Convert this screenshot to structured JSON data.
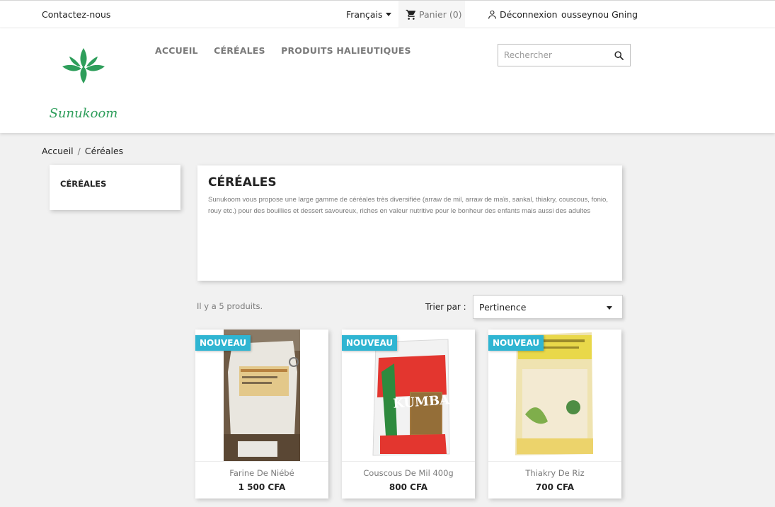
{
  "topbar": {
    "contact": "Contactez-nous",
    "language": "Français",
    "cart": "Panier (0)",
    "logout": "Déconnexion",
    "user": "ousseynou Gning"
  },
  "header": {
    "logo_text": "Sunukoom",
    "menu": [
      "ACCUEIL",
      "CÉRÉALES",
      "PRODUITS HALIEUTIQUES"
    ],
    "search_placeholder": "Rechercher"
  },
  "breadcrumb": [
    "Accueil",
    "Céréales"
  ],
  "sidebar": {
    "title": "CÉRÉALES"
  },
  "category": {
    "title": "CÉRÉALES",
    "description": "Sunukoom vous propose une large gamme de céréales très diversifiée (arraw de mil, arraw de maïs, sankal, thiakry, couscous, fonio, rouy etc.) pour des bouillies et dessert savoureux, riches en valeur nutritive pour le bonheur des enfants mais aussi des adultes"
  },
  "listing": {
    "count": "Il y a 5 produits.",
    "sort_label": "Trier par :",
    "sort_value": "Pertinence"
  },
  "products": [
    {
      "badge": "NOUVEAU",
      "name": "Farine De Niébé",
      "price": "1 500 CFA"
    },
    {
      "badge": "NOUVEAU",
      "name": "Couscous De Mil 400g",
      "price": "800 CFA"
    },
    {
      "badge": "NOUVEAU",
      "name": "Thiakry De Riz",
      "price": "700 CFA"
    }
  ],
  "colors": {
    "accent": "#2fb5d2",
    "logo_green": "#2e9e5b",
    "background": "#f1f1f1"
  }
}
